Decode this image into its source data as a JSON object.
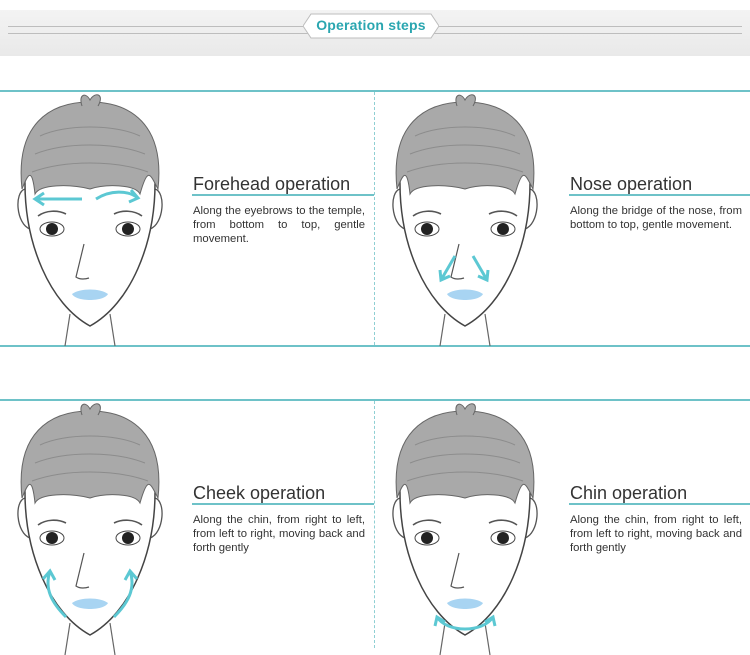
{
  "header": {
    "title": "Operation steps"
  },
  "steps": [
    {
      "title": "Forehead operation",
      "description": "Along the eyebrows to the temple, from bottom to top, gentle movement."
    },
    {
      "title": "Nose operation",
      "description": "Along the bridge of the nose, from bottom to top, gentle movement."
    },
    {
      "title": "Cheek operation",
      "description": "Along the chin, from right to left, from left to right, moving back and forth gently"
    },
    {
      "title": "Chin operation",
      "description": "Along the chin, from right to left, from left to right, moving back and forth gently"
    }
  ],
  "colors": {
    "accent": "#2aa6b0",
    "arrow": "#5cc8d3",
    "lips": "#a8d4f2",
    "hair": "#a9a9a9"
  }
}
